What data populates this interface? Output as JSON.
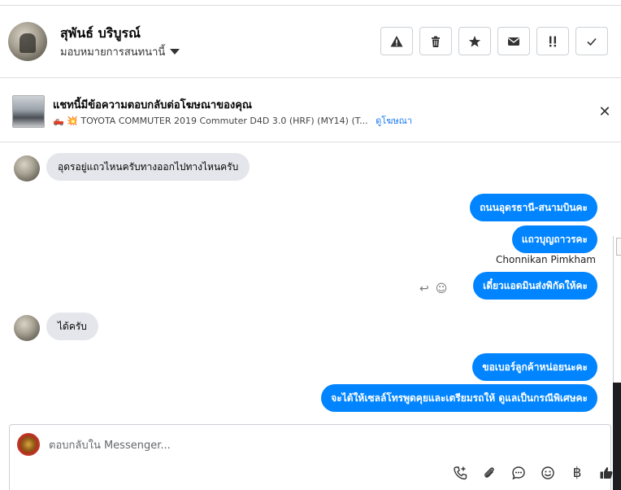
{
  "header": {
    "name": "สุพันธ์ บริบูรณ์",
    "assignment_label": "มอบหมายการสนทนานี้",
    "actions": [
      {
        "name": "report-button",
        "icon": "warning-icon"
      },
      {
        "name": "delete-button",
        "icon": "trash-icon"
      },
      {
        "name": "star-button",
        "icon": "star-icon"
      },
      {
        "name": "mark-unread-button",
        "icon": "envelope-icon"
      },
      {
        "name": "priority-button",
        "icon": "exclamation-icon"
      },
      {
        "name": "mark-done-button",
        "icon": "check-icon"
      }
    ]
  },
  "ad_banner": {
    "title": "แชทนี้มีข้อความตอบกลับต่อโฆษณาของคุณ",
    "description": "🛻 💥 TOYOTA COMMUTER 2019 Commuter D4D 3.0 (HRF) (MY14) (T...",
    "link_label": "ดูโฆษณา"
  },
  "messages": {
    "incoming_1": "อุดรอยู่แถวไหนครับทางออกไปทางไหนครับ",
    "outgoing_1": "ถนนอุดรธานี-สนามบินคะ",
    "outgoing_2": "แถวบุญถาวรคะ",
    "sender_name": "Chonnikan Pimkham",
    "outgoing_3": "เดี๋ยวแอดมินส่งพิกัดให้คะ",
    "incoming_2": "ได้ครับ",
    "outgoing_4": "ขอเบอร์ลูกค้าหน่อยนะคะ",
    "outgoing_5": "จะได้ให้เซลล์โทรพูดคุยและเตรียมรถให้ ดูแลเป็นกรณีพิเศษคะ"
  },
  "composer": {
    "placeholder": "ตอบกลับใน Messenger...",
    "tools": [
      "add-call-icon",
      "attachment-icon",
      "saved-replies-icon",
      "emoji-icon",
      "baht-payment-icon",
      "like-icon"
    ],
    "baht_symbol": "฿"
  }
}
